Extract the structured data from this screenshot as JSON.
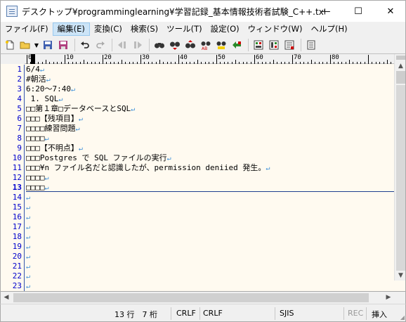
{
  "window": {
    "title": "デスクトップ¥programminglearning¥学習記録_基本情報技術者試験_C++.txt(...",
    "controls": [
      "—",
      "☐",
      "✕"
    ]
  },
  "menu": [
    "ファイル(F)",
    "編集(E)",
    "変換(C)",
    "検索(S)",
    "ツール(T)",
    "設定(O)",
    "ウィンドウ(W)",
    "ヘルプ(H)"
  ],
  "ruler": {
    "labels": [
      "0",
      "10",
      "20",
      "30",
      "40",
      "50",
      "60",
      "70",
      "80"
    ]
  },
  "editor": {
    "lines": [
      {
        "num": "1",
        "text": "6/4"
      },
      {
        "num": "2",
        "text": "#朝活"
      },
      {
        "num": "3",
        "text": "6:20～7:40"
      },
      {
        "num": "4",
        "text": " 1. SQL"
      },
      {
        "num": "5",
        "text": "□□第１章□データベースとSQL"
      },
      {
        "num": "6",
        "text": "□□□【残項目】"
      },
      {
        "num": "7",
        "text": "□□□□練習問題"
      },
      {
        "num": "8",
        "text": "□□□□"
      },
      {
        "num": "9",
        "text": "□□□【不明点】"
      },
      {
        "num": "10",
        "text": "□□□Postgres で SQL ファイルの実行"
      },
      {
        "num": "11",
        "text": "□□□¥n ファイル名だと認識したが、permission deniied 発生。"
      },
      {
        "num": "12",
        "text": "□□□□"
      },
      {
        "num": "13",
        "text": "□□□□"
      },
      {
        "num": "14",
        "text": ""
      },
      {
        "num": "15",
        "text": ""
      },
      {
        "num": "16",
        "text": ""
      },
      {
        "num": "17",
        "text": ""
      },
      {
        "num": "18",
        "text": ""
      },
      {
        "num": "19",
        "text": ""
      },
      {
        "num": "20",
        "text": ""
      },
      {
        "num": "21",
        "text": ""
      },
      {
        "num": "22",
        "text": ""
      },
      {
        "num": "23",
        "text": ""
      }
    ],
    "return_mark": "↵"
  },
  "status": {
    "position": "13 行　7 桁",
    "eol1": "CRLF",
    "eol2": "CRLF",
    "encoding": "SJIS",
    "rec": "REC",
    "mode": "挿入"
  },
  "colors": {
    "line_number": "#0000cc",
    "return_mark": "#3b8fd9",
    "editor_bg": "#fffaf0",
    "cursor_line": "#1e3f8f"
  }
}
